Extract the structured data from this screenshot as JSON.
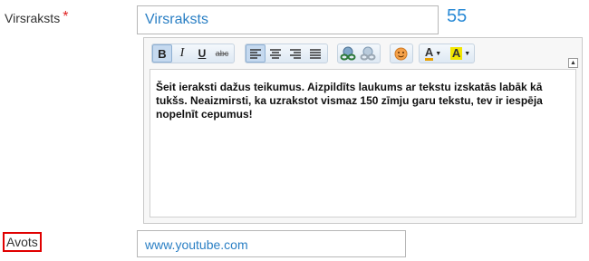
{
  "title_field": {
    "label": "Virsraksts",
    "required_mark": "*",
    "value": "Virsraksts",
    "char_count": "55"
  },
  "editor": {
    "toolbar": {
      "bold": "B",
      "italic": "I",
      "underline": "U",
      "strike": "abc",
      "text_color_glyph": "A",
      "bg_color_glyph": "A"
    },
    "collapse_glyph": "▲",
    "body": "Šeit ieraksti dažus teikumus. Aizpildīts laukums ar tekstu izskatās labāk kā tukšs. Neaizmirsti, ka uzrakstot vismaz 150 zīmju garu tekstu, tev ir iespēja nopelnīt cepumus!"
  },
  "source_field": {
    "label": "Avots",
    "value": "www.youtube.com"
  },
  "colors": {
    "accent": "#2b8bd6",
    "required": "#e02020",
    "highlight_box": "#e00000",
    "text_color_swatch": "#e8a000",
    "bg_color_swatch": "#f2e600"
  }
}
